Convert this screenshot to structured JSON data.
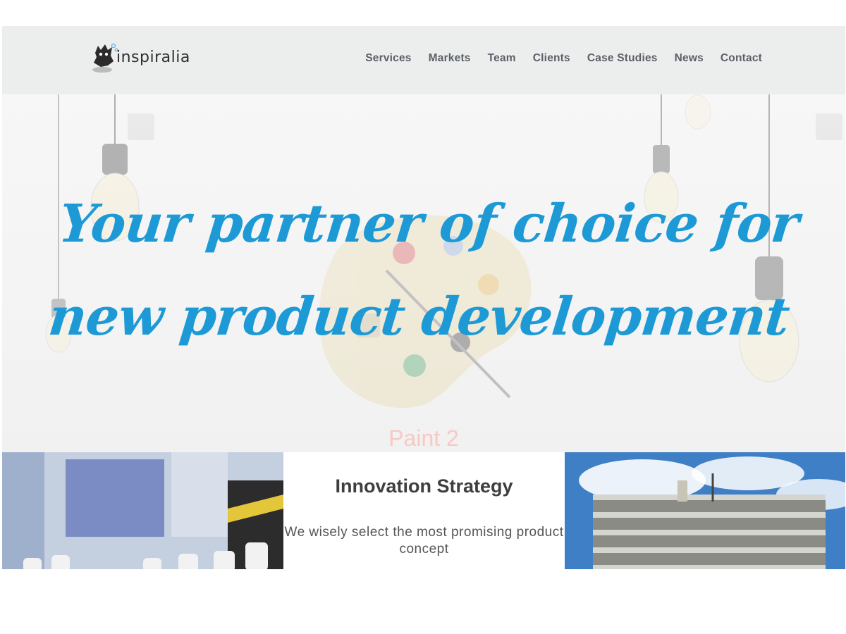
{
  "header": {
    "logo_text": "inspiralia",
    "nav": [
      "Services",
      "Markets",
      "Team",
      "Clients",
      "Case Studies",
      "News",
      "Contact"
    ]
  },
  "hero": {
    "title": "Your partner of choice for new product development",
    "caption": "Paint 2"
  },
  "feature": {
    "title": "Innovation Strategy",
    "text": "We wisely select the most promising product concept"
  },
  "colors": {
    "accent": "#1d9ad6",
    "nav_text": "#5b6068",
    "header_bg": "#eceeee",
    "caption": "#f7c9c4"
  }
}
